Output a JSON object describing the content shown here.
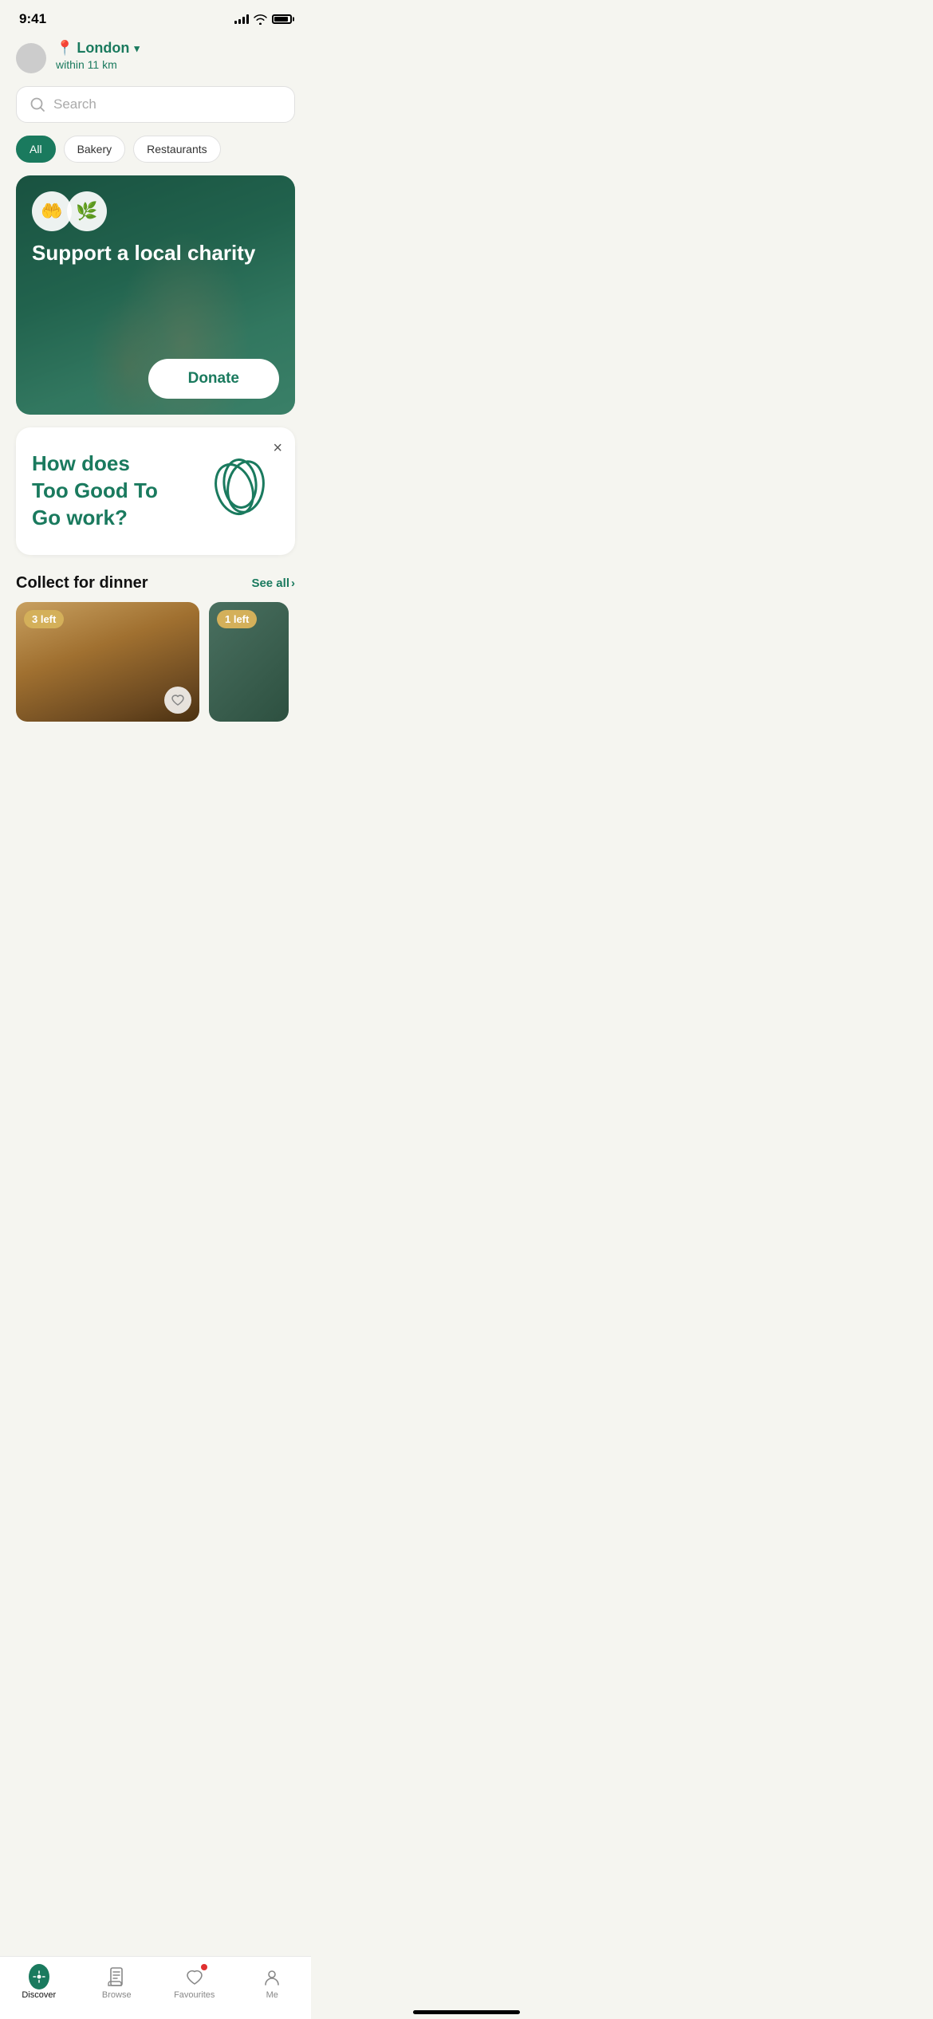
{
  "statusBar": {
    "time": "9:41"
  },
  "header": {
    "city": "London",
    "distance": "within 11 km"
  },
  "search": {
    "placeholder": "Search"
  },
  "categories": [
    {
      "label": "All",
      "active": true
    },
    {
      "label": "Bakery",
      "active": false
    },
    {
      "label": "Restaurants",
      "active": false
    }
  ],
  "charityBanner": {
    "title": "Support a local charity",
    "donateButton": "Donate"
  },
  "infoCard": {
    "question": "How does Too Good To Go work?",
    "closeLabel": "×"
  },
  "collectSection": {
    "title": "Collect for dinner",
    "seeAll": "See all"
  },
  "foodCards": [
    {
      "badge": "3 left"
    },
    {
      "badge": "1 left"
    }
  ],
  "bottomNav": {
    "items": [
      {
        "label": "Discover",
        "active": true
      },
      {
        "label": "Browse",
        "active": false
      },
      {
        "label": "Favourites",
        "active": false
      },
      {
        "label": "Me",
        "active": false
      }
    ]
  }
}
